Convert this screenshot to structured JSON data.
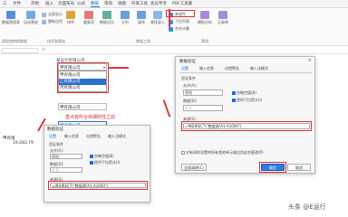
{
  "ribbon": {
    "tabs": [
      "三",
      "文件",
      "开始",
      "插入",
      "页面布局",
      "公式",
      "数据",
      "审阅",
      "视图",
      "开发工具",
      "会员专享",
      "PDF工具集"
    ],
    "active_tab": "数据",
    "buttons": [
      "数据透视表",
      "自动筛选",
      "全部显示",
      "重新应用",
      "排序",
      "重复项",
      "数据对比",
      "分列",
      "填充",
      "查找录入",
      "有效性",
      "下拉列表",
      "合并计算",
      "模拟分析",
      "记录单"
    ],
    "group_labels": [
      "获取和转换数据",
      "排序和筛选",
      "数据工具",
      "预测"
    ]
  },
  "sheet": {
    "dropdown_options": [
      "甲有限公司",
      "乙有限公司",
      "丙有限公司"
    ],
    "cell_company": "甲有限公司",
    "cell_header": "某设计有限公司",
    "cell_title": "甲有限公司",
    "cell_banner": "重点有所合体细则性之前",
    "cell_selected": "甲有限公司",
    "row_label": "甲有限",
    "amount": "19,283.79"
  },
  "dialog_main": {
    "title": "数据验证",
    "tabs": [
      "设置",
      "输入信息",
      "出错警告",
      "输入法模式"
    ],
    "section_title": "验证条件",
    "allow_label": "允许(A):",
    "allow_value": "序列",
    "data_label": "数据(D):",
    "data_value": "介于",
    "ignore_blank": "忽略空值(B)",
    "dropdown_arrow": "提供下拉箭头(I)",
    "source_label": "来源(S):",
    "source_value": "=INDIRECT(\"数据源!A1:A1000\")",
    "apply_all": "对有同样设置的所有其他单元格应用这些更改(P)",
    "clear_all": "全部清除(C)",
    "ok": "确定",
    "cancel": "取消"
  },
  "dialog_small": {
    "title": "数据验证",
    "tabs": [
      "设置",
      "输入信息",
      "出错警告",
      "输入法模式"
    ],
    "section_title": "验证条件",
    "allow_label": "允许(A):",
    "allow_value": "序列",
    "data_label": "数据(D):",
    "data_value": "介于",
    "ignore_blank": "忽略空值(B)",
    "dropdown_arrow": "提供下拉箭头(I)",
    "source_label": "来源(S):",
    "source_value": "=INDIRECT(\"数据源!A1:A1000\")"
  },
  "watermark": "头条 @E运行",
  "colors": {
    "accent": "#1a6fd6",
    "annotation": "#d83a3a"
  }
}
